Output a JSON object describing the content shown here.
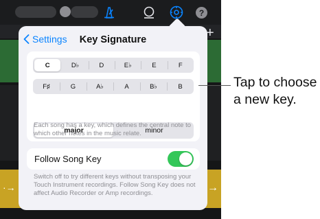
{
  "popover": {
    "back_label": "Settings",
    "title": "Key Signature",
    "keys_row1": [
      "C",
      "D♭",
      "D",
      "E♭",
      "E",
      "F"
    ],
    "keys_row2": [
      "F♯",
      "G",
      "A♭",
      "A",
      "B♭",
      "B"
    ],
    "selected_key": "C",
    "scale_options": [
      "major",
      "minor"
    ],
    "selected_scale": "major",
    "key_description": "Each song has a key, which defines the central note to which other notes in the music relate.",
    "follow_label": "Follow Song Key",
    "follow_enabled": true,
    "follow_description": "Switch off to try different keys without transposing your Touch Instrument recordings. Follow Song Key does not affect Audio Recorder or Amp recordings."
  },
  "toolbar": {
    "help_label": "?",
    "add_label": "+",
    "icons": [
      "record-icon",
      "metronome-icon",
      "master-fx-icon",
      "settings-icon",
      "help-icon"
    ]
  },
  "callout": {
    "text": "Tap to choose a new key."
  },
  "colors": {
    "accent": "#0a84ff",
    "toggle_on": "#34c759",
    "track_green": "#2c6b34",
    "track_yellow": "#c8a324"
  }
}
